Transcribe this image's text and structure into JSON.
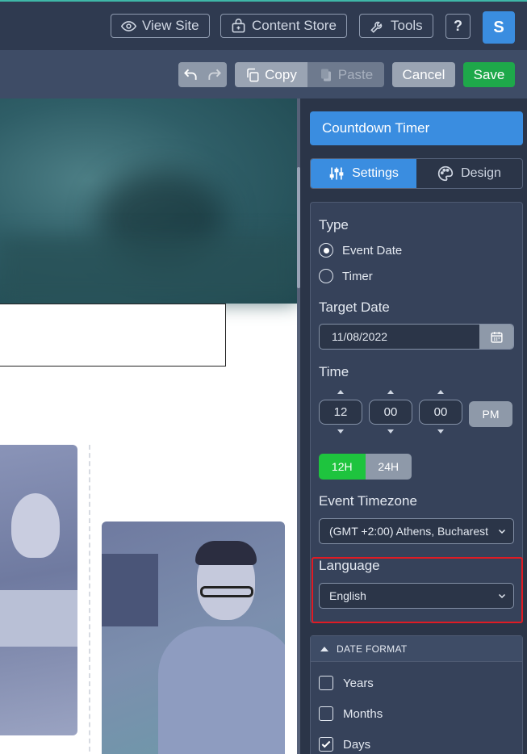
{
  "topbar": {
    "view_site": "View Site",
    "content_store": "Content Store",
    "tools": "Tools",
    "help": "?",
    "avatar_initial": "S"
  },
  "actionbar": {
    "copy": "Copy",
    "paste": "Paste",
    "cancel": "Cancel",
    "save": "Save"
  },
  "panel": {
    "widget_title": "Countdown Timer",
    "tabs": [
      {
        "label": "Settings",
        "icon": "sliders-icon",
        "active": true
      },
      {
        "label": "Design",
        "icon": "palette-icon",
        "active": false
      }
    ],
    "type_label": "Type",
    "type_options": [
      {
        "label": "Event Date",
        "selected": true
      },
      {
        "label": "Timer",
        "selected": false
      }
    ],
    "target_date_label": "Target Date",
    "target_date_value": "11/08/2022",
    "time_label": "Time",
    "time_hours": "12",
    "time_minutes": "00",
    "time_seconds": "00",
    "ampm": "PM",
    "format_12h": "12H",
    "format_24h": "24H",
    "timezone_label": "Event Timezone",
    "timezone_value": "(GMT +2:00) Athens, Bucharest",
    "language_label": "Language",
    "language_value": "English",
    "date_format_heading": "DATE FORMAT",
    "date_format_options": [
      {
        "label": "Years",
        "checked": false
      },
      {
        "label": "Months",
        "checked": false
      },
      {
        "label": "Days",
        "checked": true
      }
    ]
  },
  "colors": {
    "accent": "#3a8de0",
    "save": "#1ea84a",
    "toggle_on": "#1ec43e",
    "highlight": "#e01b24"
  }
}
